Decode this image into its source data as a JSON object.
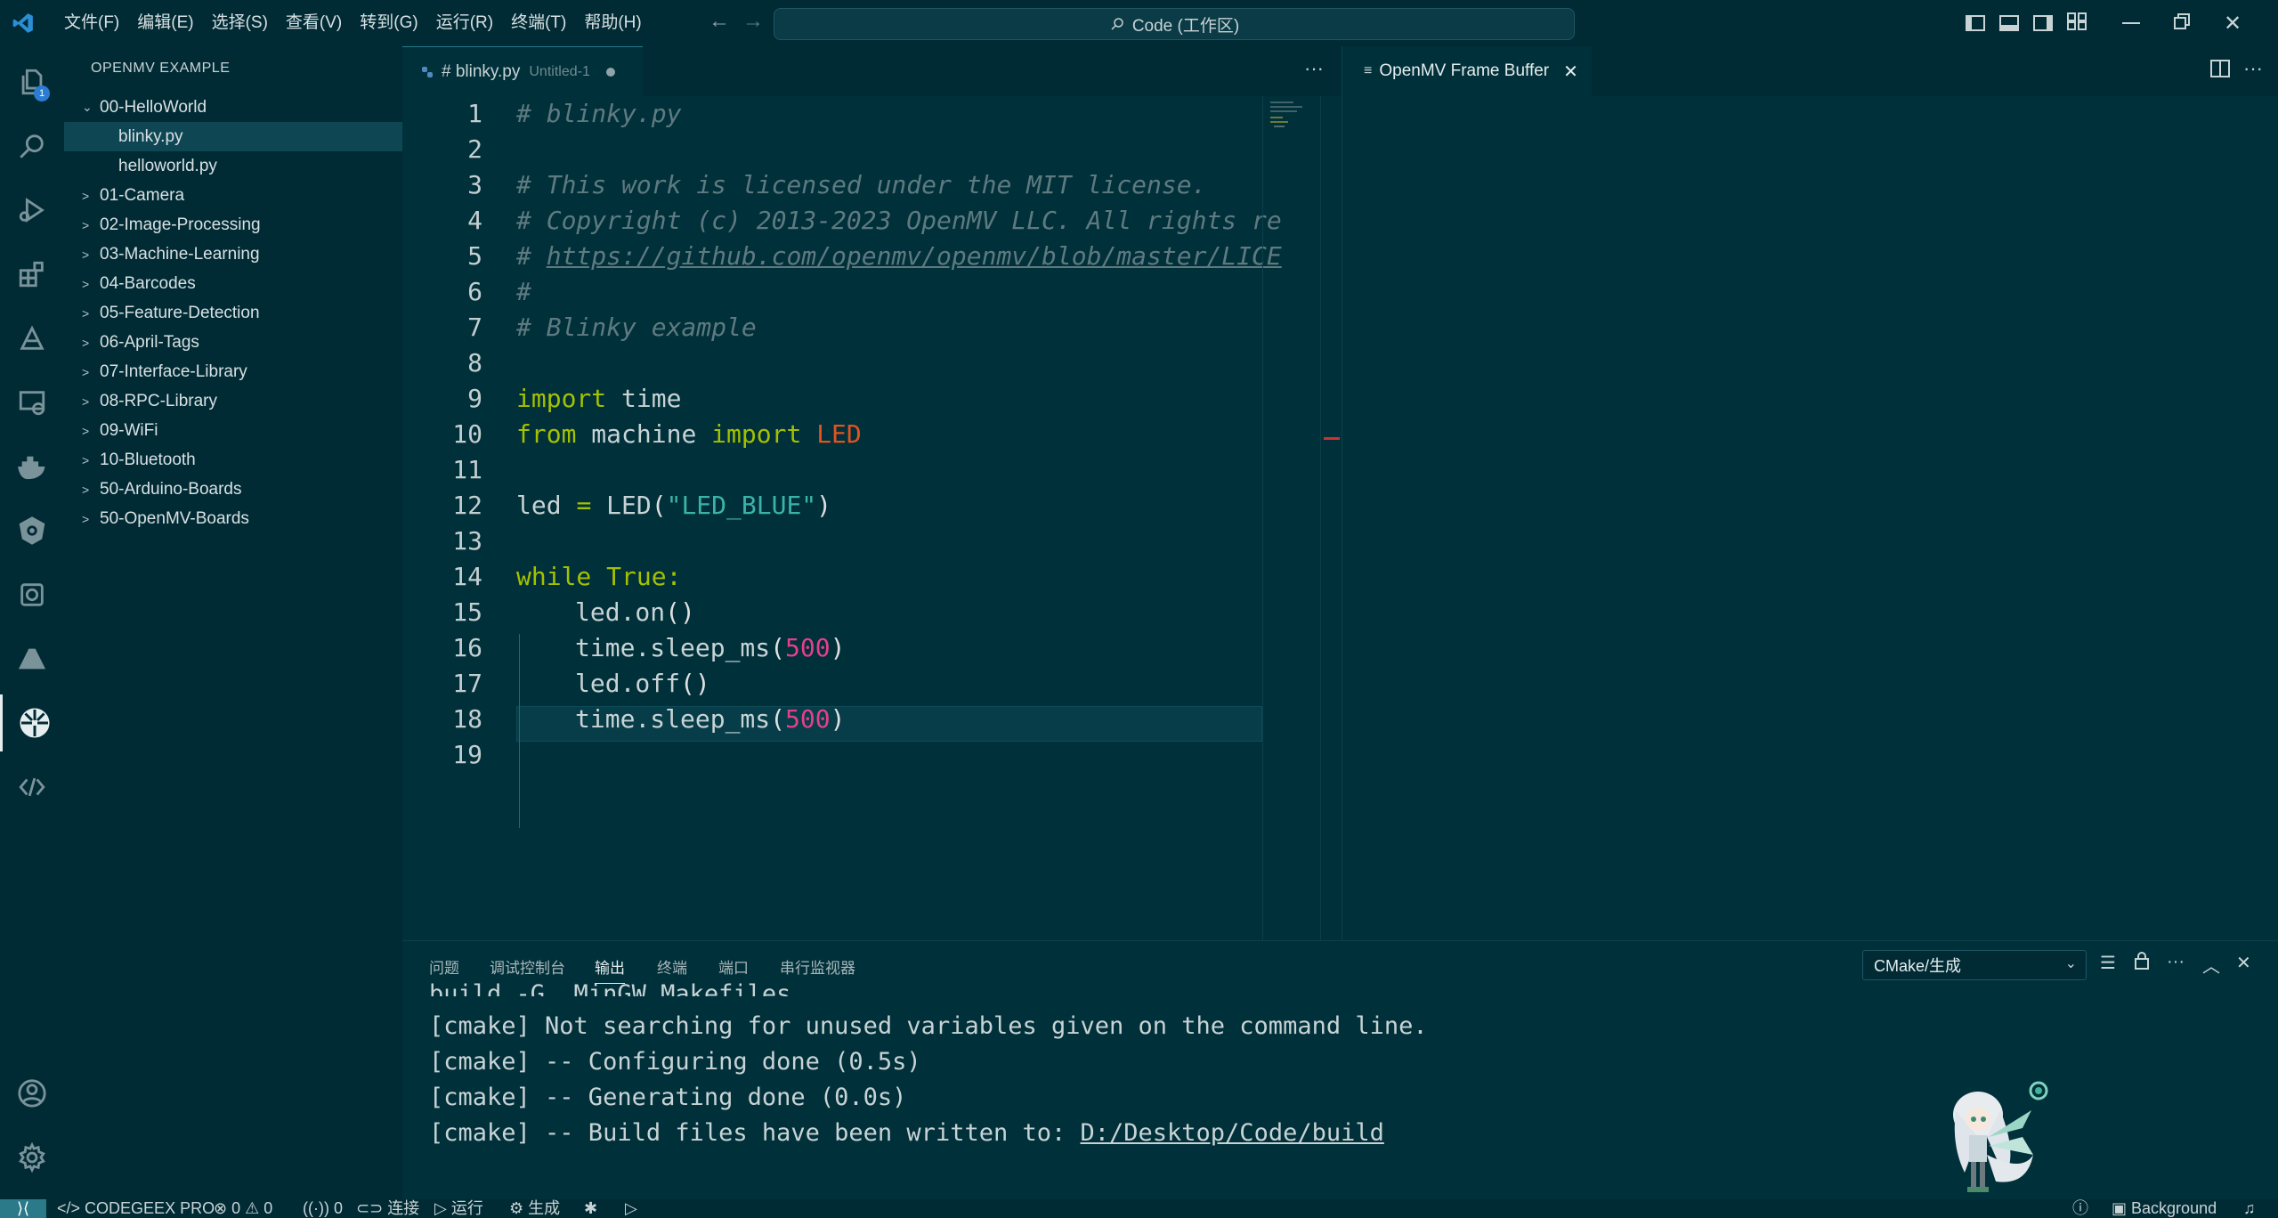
{
  "titlebar": {
    "menu": [
      "文件(F)",
      "编辑(E)",
      "选择(S)",
      "查看(V)",
      "转到(G)",
      "运行(R)",
      "终端(T)",
      "帮助(H)"
    ],
    "search_text": "Code (工作区)"
  },
  "activity_bar": {
    "explorer_badge": "1"
  },
  "sidebar": {
    "title": "OPENMV EXAMPLE",
    "items": [
      {
        "label": "00-HelloWorld",
        "expanded": true
      },
      {
        "label": "blinky.py",
        "child": true,
        "selected": true
      },
      {
        "label": "helloworld.py",
        "child": true
      },
      {
        "label": "01-Camera"
      },
      {
        "label": "02-Image-Processing"
      },
      {
        "label": "03-Machine-Learning"
      },
      {
        "label": "04-Barcodes"
      },
      {
        "label": "05-Feature-Detection"
      },
      {
        "label": "06-April-Tags"
      },
      {
        "label": "07-Interface-Library"
      },
      {
        "label": "08-RPC-Library"
      },
      {
        "label": "09-WiFi"
      },
      {
        "label": "10-Bluetooth"
      },
      {
        "label": "50-Arduino-Boards"
      },
      {
        "label": "50-OpenMV-Boards"
      }
    ]
  },
  "editor": {
    "tab_name": "# blinky.py",
    "tab_desc": "Untitled-1",
    "line_numbers": [
      "1",
      "2",
      "3",
      "4",
      "5",
      "6",
      "7",
      "8",
      "9",
      "10",
      "11",
      "12",
      "13",
      "14",
      "15",
      "16",
      "17",
      "18",
      "19"
    ],
    "code": {
      "l1": "# blinky.py",
      "l3": "# This work is licensed under the MIT license.",
      "l4": "# Copyright (c) 2013-2023 OpenMV LLC. All rights re",
      "l5_hash": "# ",
      "l5_url": "https://github.com/openmv/openmv/blob/master/LICE",
      "l6": "#",
      "l7": "# Blinky example",
      "import": "import",
      "time": "time",
      "from": "from",
      "machine": "machine",
      "LED": "LED",
      "led": "led",
      "eq": "=",
      "led_str": "\"LED_BLUE\"",
      "while": "while",
      "true": "True",
      "colon": ":",
      "led_on": "led.on",
      "led_off": "led.off",
      "sleep": "time.sleep_ms",
      "ms": "500",
      "open": "(",
      "close": ")",
      "empty": "()"
    }
  },
  "frame_buffer": {
    "tab_name": "OpenMV Frame Buffer"
  },
  "panel": {
    "tabs": [
      "问题",
      "调试控制台",
      "输出",
      "终端",
      "端口",
      "串行监视器"
    ],
    "active_tab": "输出",
    "channel": "CMake/生成",
    "output": [
      "build -G  MinGW Makefiles",
      "[cmake] Not searching for unused variables given on the command line.",
      "[cmake] -- Configuring done (0.5s)",
      "[cmake] -- Generating done (0.0s)"
    ],
    "last_line_prefix": "[cmake] -- Build files have been written to: ",
    "last_line_path": "D:/Desktop/Code/build"
  },
  "statusbar": {
    "codegeex": "CODEGEEX PRO",
    "errors": "0",
    "warnings": "0",
    "ports": "0",
    "connect": "连接",
    "run": "运行",
    "build": "生成",
    "background": "Background"
  }
}
